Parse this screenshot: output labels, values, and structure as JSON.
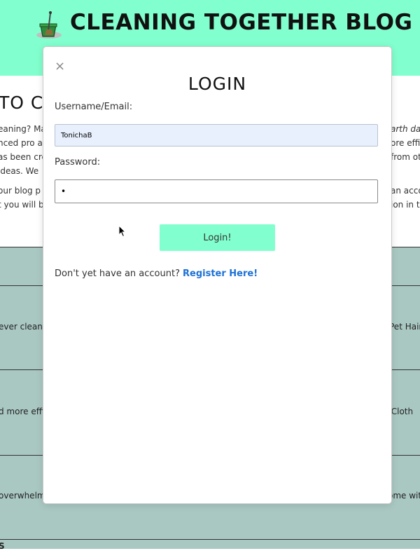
{
  "site": {
    "title": "CLEANING TOGETHER BLOG",
    "logo_icon": "bucket-broom-icon",
    "header_color": "#82ffce",
    "posts_bg_color": "#aac8c2"
  },
  "intro": {
    "heading": "TO C",
    "lines": [
      "eaning? Ma",
      "nced pro a",
      "as been cre",
      "ideas. We",
      "our blog p",
      "t you will b"
    ],
    "lines_right": [
      "arth da",
      "ore effic",
      "from ot",
      "",
      "an acco",
      "ion in t"
    ]
  },
  "posts": {
    "left_snippets": [
      "ever cleanin",
      "d more effi",
      "overwhelmi"
    ],
    "right_snippets": [
      "Pet Hair",
      "r Cloth",
      "ome wit"
    ],
    "bottom_fragment": "S"
  },
  "modal": {
    "close_label": "×",
    "title": "LOGIN",
    "username_label": "Username/Email:",
    "username_value": "TonichaB",
    "password_label": "Password:",
    "password_value": "•",
    "login_button": "Login!",
    "register_prompt": "Don't yet have an account?",
    "register_link": "Register Here!"
  }
}
